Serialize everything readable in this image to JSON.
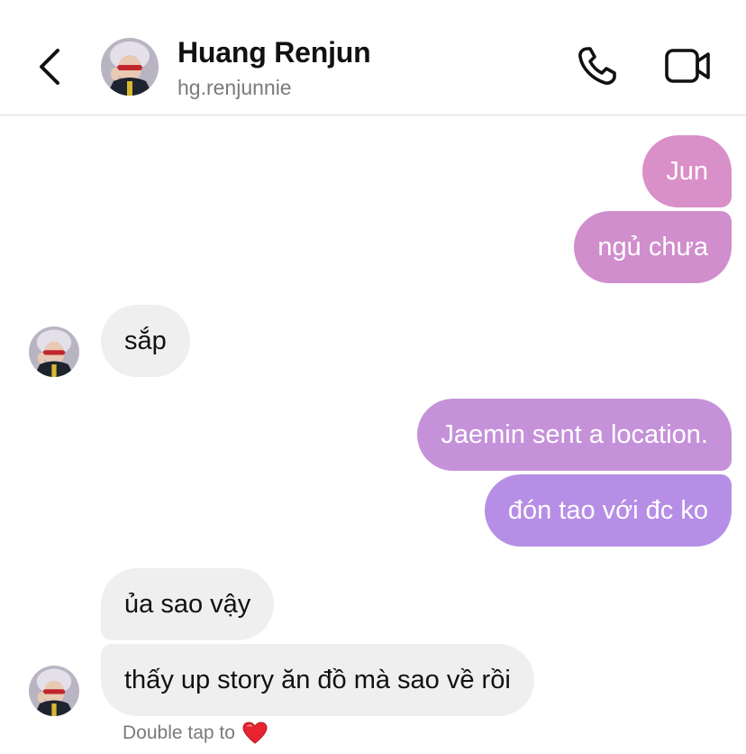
{
  "header": {
    "name": "Huang Renjun",
    "handle": "hg.renjunnie",
    "back_icon": "chevron-left-icon",
    "call_icon": "phone-icon",
    "video_icon": "video-camera-icon"
  },
  "messages": [
    {
      "direction": "outgoing",
      "text": "Jun"
    },
    {
      "direction": "outgoing",
      "text": "ngủ chưa"
    },
    {
      "direction": "incoming",
      "text": "sắp"
    },
    {
      "direction": "outgoing",
      "text": "Jaemin sent a location."
    },
    {
      "direction": "outgoing",
      "text": "đón tao với đc ko"
    },
    {
      "direction": "incoming",
      "text": "ủa sao vậy"
    },
    {
      "direction": "incoming",
      "text": "thấy up story ăn đồ mà sao về rồi"
    }
  ],
  "reaction_hint": {
    "text": "Double tap to",
    "icon": "heart-icon"
  },
  "colors": {
    "outgoing_top": "#d98fc8",
    "outgoing_mid": "#c592da",
    "outgoing_bottom": "#b68ee6",
    "incoming": "#efefef",
    "heart": "#e8232f"
  }
}
